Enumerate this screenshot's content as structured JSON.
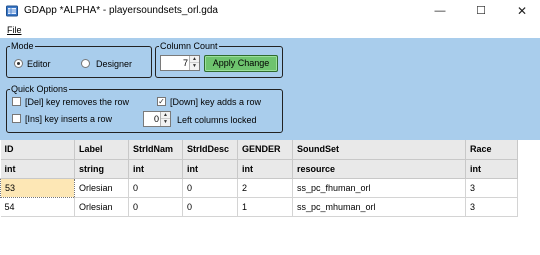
{
  "window": {
    "title": "GDApp *ALPHA* -  playersoundsets_orl.gda",
    "icon": "app-icon",
    "minimize": "—",
    "maximize": "☐",
    "close": "✕"
  },
  "menu": {
    "file": "File"
  },
  "mode": {
    "title": "Mode",
    "editor": "Editor",
    "designer": "Designer",
    "selected": "Editor"
  },
  "column_count": {
    "title": "Column Count",
    "value": "7",
    "apply": "Apply Change"
  },
  "quick_options": {
    "title": "Quick Options",
    "del_removes": {
      "label": "[Del] key removes the row",
      "checked": false
    },
    "ins_inserts": {
      "label": "[Ins] key inserts a row",
      "checked": false
    },
    "down_adds": {
      "label": "[Down] key adds a row",
      "checked": true
    },
    "left_locked_value": "0",
    "left_locked_label": "Left columns locked"
  },
  "grid": {
    "headers": [
      "ID",
      "Label",
      "StrIdNam",
      "StrIdDesc",
      "GENDER",
      "SoundSet",
      "Race"
    ],
    "types": [
      "int",
      "string",
      "int",
      "int",
      "int",
      "resource",
      "int"
    ],
    "rows": [
      [
        "53",
        "Orlesian",
        "0",
        "0",
        "2",
        "ss_pc_fhuman_orl",
        "3"
      ],
      [
        "54",
        "Orlesian",
        "0",
        "0",
        "1",
        "ss_pc_mhuman_orl",
        "3"
      ]
    ],
    "selected_cell": "53",
    "colors": {
      "header_bg": "#e9e9e9",
      "selected_bg": "#fde7b5",
      "panel_bg": "#a9cdec",
      "apply_bg": "#6ec36e"
    }
  }
}
